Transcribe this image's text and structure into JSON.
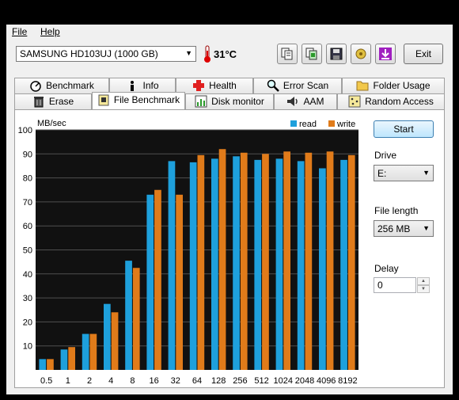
{
  "menu": {
    "file": "File",
    "help": "Help"
  },
  "toolbar": {
    "drive": "SAMSUNG HD103UJ (1000 GB)",
    "temperature": "31°C",
    "exit_label": "Exit",
    "buttons": [
      "copy-text-icon",
      "copy-screenshot-icon",
      "save-icon",
      "options-icon",
      "download-icon"
    ]
  },
  "tabs_row1": [
    "Benchmark",
    "Info",
    "Health",
    "Error Scan",
    "Folder Usage"
  ],
  "tabs_row2": [
    "Erase",
    "File Benchmark",
    "Disk monitor",
    "AAM",
    "Random Access"
  ],
  "active_tab": "File Benchmark",
  "side": {
    "start_label": "Start",
    "drive_label": "Drive",
    "drive_value": "E:",
    "file_length_label": "File length",
    "file_length_value": "256 MB",
    "delay_label": "Delay",
    "delay_value": "0"
  },
  "chart_data": {
    "type": "bar",
    "ylabel": "MB/sec",
    "ylim": [
      0,
      100
    ],
    "yticks": [
      10,
      20,
      30,
      40,
      50,
      60,
      70,
      80,
      90,
      100
    ],
    "categories": [
      "0.5",
      "1",
      "2",
      "4",
      "8",
      "16",
      "32",
      "64",
      "128",
      "256",
      "512",
      "1024",
      "2048",
      "4096",
      "8192"
    ],
    "series": [
      {
        "name": "read",
        "color": "#1ea0dc",
        "values": [
          4.5,
          8.5,
          15,
          27.5,
          45.5,
          73,
          87,
          86.5,
          88,
          89,
          87.5,
          88,
          87,
          84,
          87.5
        ]
      },
      {
        "name": "write",
        "color": "#e07b1a",
        "values": [
          4.5,
          9.5,
          15,
          24,
          42.5,
          75,
          73,
          89.5,
          92,
          90.5,
          90,
          91,
          90.5,
          91,
          89.5
        ]
      }
    ],
    "grid": true,
    "legend": "top-right"
  },
  "colors": {
    "plot_bg": "#111111",
    "grid": "#505050",
    "accent": "#3c7fb1"
  }
}
